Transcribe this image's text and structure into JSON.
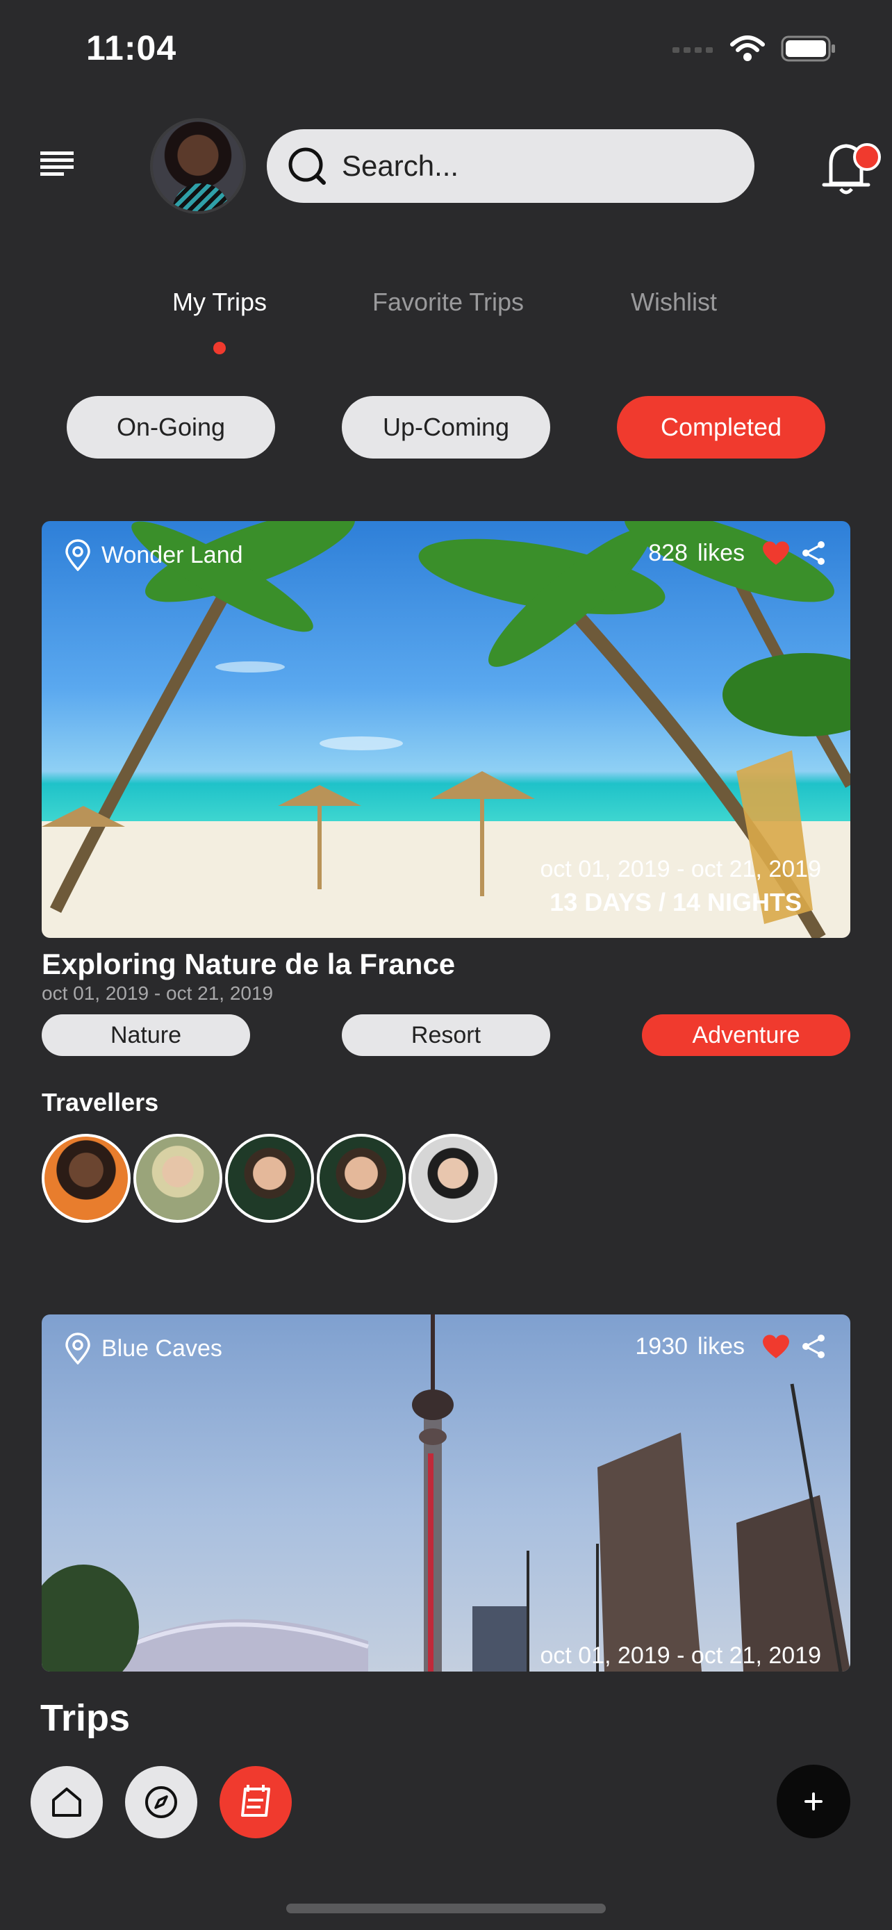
{
  "status": {
    "time": "11:04"
  },
  "search": {
    "placeholder": "Search..."
  },
  "tabs": [
    {
      "label": "My Trips",
      "active": true
    },
    {
      "label": "Favorite Trips",
      "active": false
    },
    {
      "label": "Wishlist",
      "active": false
    }
  ],
  "filters": [
    {
      "label": "On-Going",
      "active": false
    },
    {
      "label": "Up-Coming",
      "active": false
    },
    {
      "label": "Completed",
      "active": true
    }
  ],
  "trips": [
    {
      "location": "Wonder Land",
      "likes": "828",
      "likes_label": "likes",
      "date_range": "oct 01, 2019 - oct 21, 2019",
      "duration": "13 DAYS / 14 NIGHTS",
      "title": "Exploring Nature de la France",
      "subtitle_date": "oct 01, 2019 - oct 21, 2019",
      "tags": [
        {
          "label": "Nature",
          "active": false
        },
        {
          "label": "Resort",
          "active": false
        },
        {
          "label": "Adventure",
          "active": true
        }
      ],
      "travellers_title": "Travellers"
    },
    {
      "location": "Blue Caves",
      "likes": "1930",
      "likes_label": "likes",
      "date_range": "oct 01, 2019 - oct 21, 2019"
    }
  ],
  "bottom": {
    "section_title": "Trips"
  },
  "colors": {
    "accent": "#f03a2e",
    "background": "#2a2a2c",
    "pill": "#e6e6e8"
  },
  "icons": [
    "menu-icon",
    "search-icon",
    "bell-icon",
    "location-pin-icon",
    "heart-icon",
    "share-icon",
    "home-icon",
    "compass-icon",
    "trips-icon",
    "plus-icon"
  ]
}
